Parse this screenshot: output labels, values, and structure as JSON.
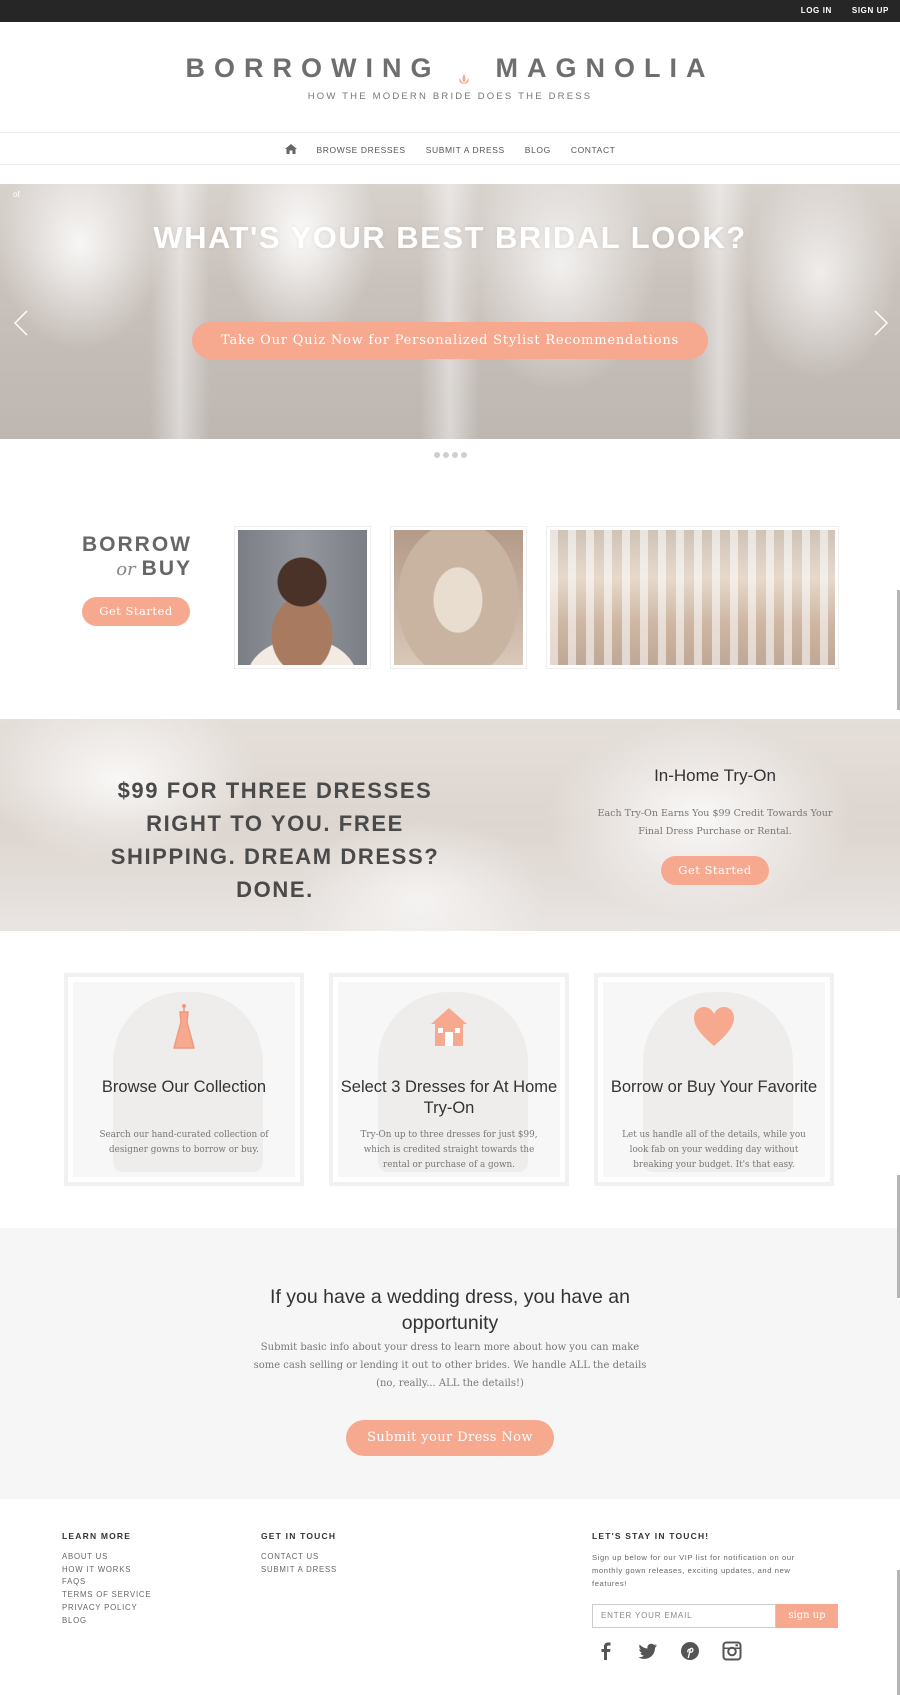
{
  "topbar": {
    "login": "LOG IN",
    "signup": "SIGN UP"
  },
  "brand": {
    "name_left": "BORROWING",
    "name_right": "MAGNOLIA",
    "tagline": "HOW THE MODERN BRIDE DOES THE DRESS",
    "accent_color": "#f7a98f"
  },
  "nav": {
    "home_icon": "home-icon",
    "items": [
      "BROWSE DRESSES",
      "SUBMIT A DRESS",
      "BLOG",
      "CONTACT"
    ]
  },
  "hero": {
    "corner_text": "of",
    "title": "WHAT'S YOUR BEST BRIDAL LOOK?",
    "cta": "Take Our Quiz Now for Personalized Stylist Recommendations",
    "prev_icon": "chevron-left-icon",
    "next_icon": "chevron-right-icon",
    "dots": 4
  },
  "borrow_or_buy": {
    "line1": "BORROW",
    "or": "or",
    "line2": "BUY",
    "cta": "Get Started"
  },
  "promo": {
    "headline": "$99 FOR THREE DRESSES RIGHT TO YOU. FREE SHIPPING. DREAM DRESS? DONE.",
    "side_title": "In-Home Try-On",
    "side_desc": "Each Try-On Earns You $99 Credit Towards Your Final Dress Purchase or Rental.",
    "cta": "Get Started"
  },
  "steps": [
    {
      "icon": "dress-icon",
      "title": "Browse Our Collection",
      "desc": "Search our hand-curated collection of designer gowns to borrow or buy."
    },
    {
      "icon": "house-icon",
      "title": "Select 3 Dresses for At Home Try-On",
      "desc": "Try-On up to three dresses for just $99, which is credited straight towards the rental or purchase of a gown."
    },
    {
      "icon": "heart-icon",
      "title": "Borrow or Buy Your Favorite",
      "desc": "Let us handle all of the details, while you look fab on your wedding day without breaking your budget. It's that easy."
    }
  ],
  "submit": {
    "title": "If you have a wedding dress, you have an opportunity",
    "desc": "Submit basic info about your dress to learn more about how you can make some cash selling or lending it out to other brides. We handle ALL the details (no, really... ALL the details!)",
    "cta": "Submit your Dress Now"
  },
  "footer": {
    "learn_more": {
      "heading": "LEARN MORE",
      "links": [
        "ABOUT US",
        "HOW IT WORKS",
        "FAQS",
        "TERMS OF SERVICE",
        "PRIVACY POLICY",
        "BLOG"
      ]
    },
    "get_in_touch": {
      "heading": "GET IN TOUCH",
      "links": [
        "CONTACT US",
        "SUBMIT A DRESS"
      ]
    },
    "stay_in_touch": {
      "heading": "LET'S STAY IN TOUCH!",
      "desc": "Sign up below for our VIP list for notification on our monthly gown releases, exciting updates, and new features!",
      "email_placeholder": "ENTER YOUR EMAIL",
      "signup": "sign up"
    },
    "socials": [
      "facebook-icon",
      "twitter-icon",
      "pinterest-icon",
      "instagram-icon"
    ]
  }
}
